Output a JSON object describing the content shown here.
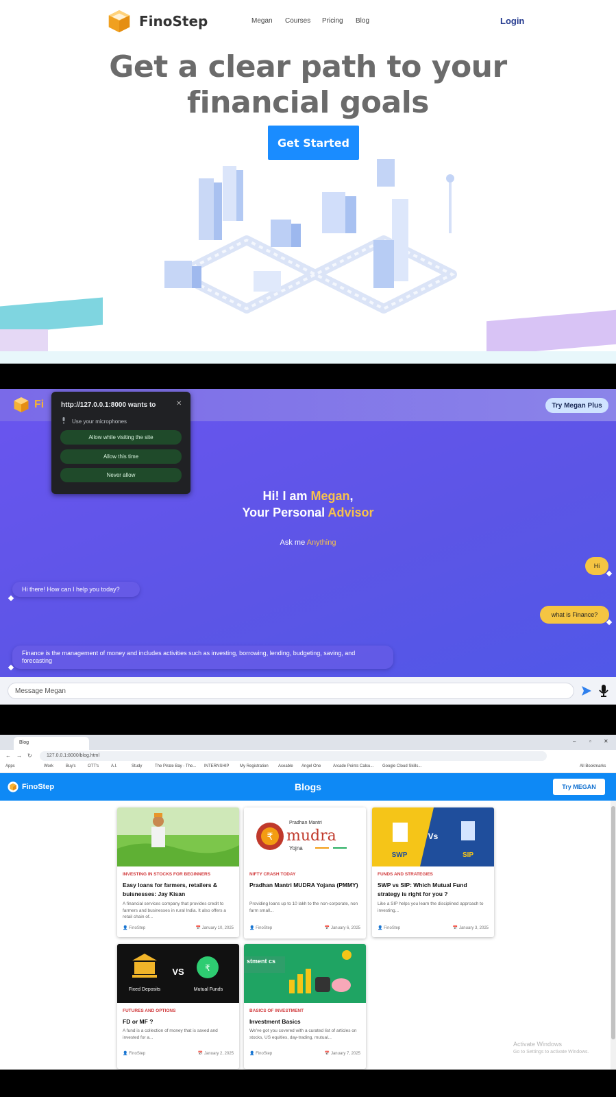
{
  "landing": {
    "brand": "FinoStep",
    "nav": [
      "Megan",
      "Courses",
      "Pricing",
      "Blog"
    ],
    "login": "Login",
    "hero_line1": "Get a clear path to your",
    "hero_line2": "financial goals",
    "cta": "Get Started"
  },
  "chat": {
    "brand_partial": "Fi",
    "try_plus": "Try Megan Plus",
    "permission": {
      "title": "http://127.0.0.1:8000 wants to",
      "close": "✕",
      "sub": "Use your microphones",
      "allow_visit": "Allow while visiting the site",
      "allow_once": "Allow this time",
      "never": "Never allow"
    },
    "greeting_hi": "Hi! I am ",
    "greeting_name": "Megan",
    "greeting_comma": ",",
    "greeting_your": "Your Personal ",
    "greeting_advisor": "Advisor",
    "ask_prefix": "Ask me ",
    "ask_word": "Anything",
    "messages": [
      {
        "from": "user",
        "text": "Hi"
      },
      {
        "from": "bot",
        "text": "Hi there! How can I help you today?"
      },
      {
        "from": "user",
        "text": "what is Finance?"
      },
      {
        "from": "bot",
        "text": "Finance is the management of money and includes activities such as investing, borrowing, lending, budgeting, saving, and forecasting"
      }
    ],
    "input_placeholder": "Message Megan"
  },
  "browser": {
    "tab_title": "Blog",
    "url": "127.0.0.1:8000/blog.html",
    "bookmarks": [
      "Apps",
      "Work",
      "Buy's",
      "OTT's",
      "A.I.",
      "Study",
      "The Pirate Bay - The...",
      "INTERNSHIP",
      "My Registration",
      "Aceable",
      "Angel One",
      "Arcade Points Calcu...",
      "Google Cloud Skills...",
      "All Bookmarks"
    ]
  },
  "blogs": {
    "brand": "FinoStep",
    "title": "Blogs",
    "try_button": "Try MEGAN",
    "cards": [
      {
        "category": "INVESTING IN STOCKS FOR BEGINNERS",
        "title": "Easy loans for farmers, retailers & buisnesses: Jay Kisan",
        "desc": "A financial services company that provides credit to farmers and businesses in rural India. It also offers a retail chain of...",
        "author": "FinoStep",
        "date": "January 10, 2025"
      },
      {
        "category": "NIFTY CRASH TODAY",
        "title": "Pradhan Mantri MUDRA Yojana (PMMY)",
        "desc": "Providing loans up to 10 lakh to the non-corporate, non farm small...",
        "author": "FinoStep",
        "date": "January 6, 2025"
      },
      {
        "category": "FUNDS AND STRATEGIES",
        "title": "SWP vs SIP: Which Mutual Fund strategy is right for you ?",
        "desc": "Like a SIP helps you learn the disciplined approach to investing...",
        "author": "FinoStep",
        "date": "January 3, 2025"
      },
      {
        "category": "FUTURES AND OPTIONS",
        "title": "FD or MF ?",
        "desc": "A fund is a collection of money that is saved and invested for a...",
        "author": "FinoStep",
        "date": "January 2, 2025"
      },
      {
        "category": "BASICS OF INVESTMENT",
        "title": "Investment Basics",
        "desc": "We've got you covered with a curated list of articles on stocks, US equities, day-trading, mutual...",
        "author": "FinoStep",
        "date": "January 7, 2025"
      }
    ],
    "img_text": {
      "mudra_top": "Pradhan Mantri",
      "mudra_main": "mudra",
      "mudra_sub": "Yojna",
      "swp": "SWP",
      "vs": "Vs",
      "sip": "SIP",
      "fd": "Fixed Deposits",
      "vs2": "VS",
      "mf": "Mutual Funds",
      "inv": "stment\ncs"
    }
  },
  "os": {
    "activate_line1": "Activate Windows",
    "activate_line2": "Go to Settings to activate Windows."
  }
}
